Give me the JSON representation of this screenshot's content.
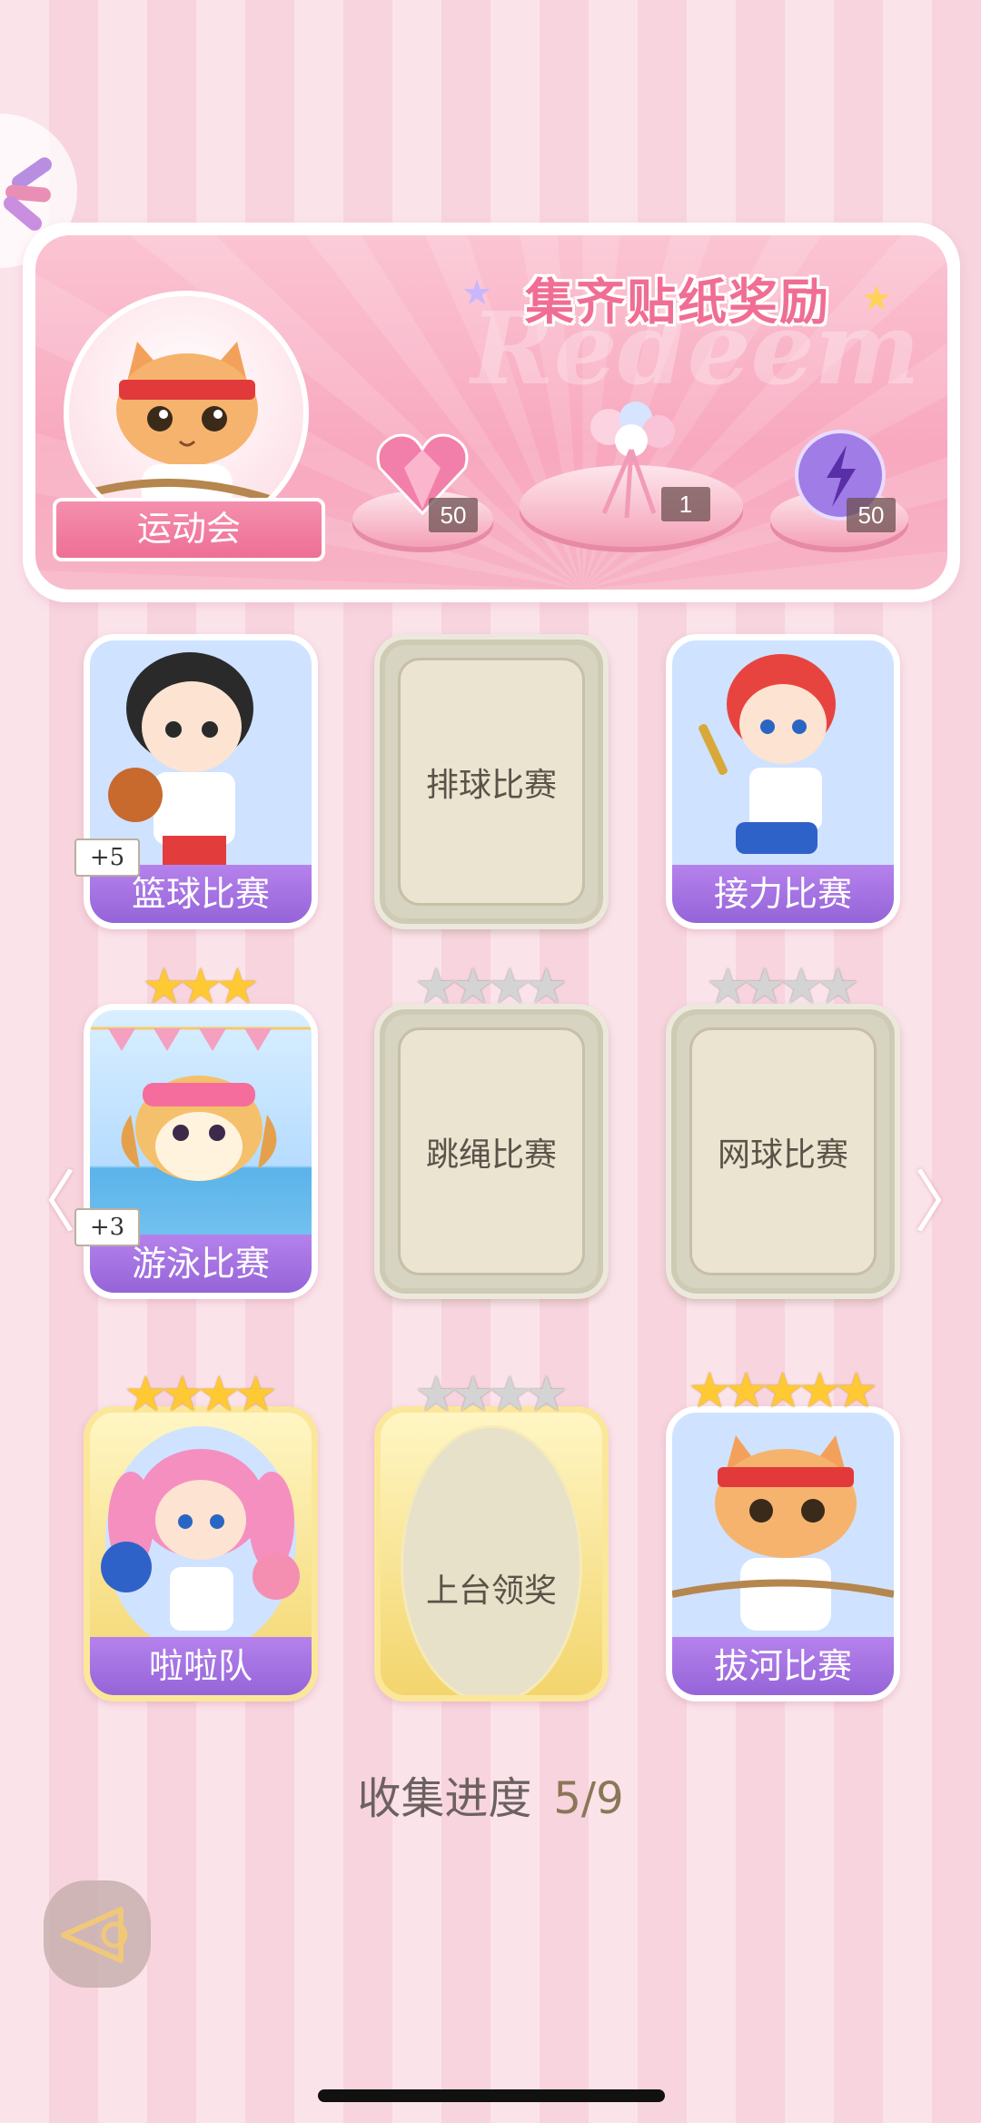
{
  "header": {
    "title": "集齐贴纸奖励",
    "watermark": "Redeem"
  },
  "event": {
    "name": "运动会"
  },
  "rewards": [
    {
      "icon": "pink-heart-gem-icon",
      "quantity": "50"
    },
    {
      "icon": "ribbon-bouquet-icon",
      "quantity": "1"
    },
    {
      "icon": "purple-energy-orb-icon",
      "quantity": "50"
    }
  ],
  "cards": [
    {
      "name": "篮球比赛",
      "state": "collected",
      "stars": 0,
      "bonus": "+5"
    },
    {
      "name": "排球比赛",
      "state": "locked",
      "stars": 0
    },
    {
      "name": "接力比赛",
      "state": "collected",
      "stars": 0
    },
    {
      "name": "游泳比赛",
      "state": "collected",
      "stars": 3,
      "bonus": "+3"
    },
    {
      "name": "跳绳比赛",
      "state": "locked",
      "stars": 4
    },
    {
      "name": "网球比赛",
      "state": "locked",
      "stars": 4
    },
    {
      "name": "啦啦队",
      "state": "collected",
      "stars": 4
    },
    {
      "name": "上台领奖",
      "state": "locked-gold",
      "stars": 4
    },
    {
      "name": "拔河比赛",
      "state": "collected",
      "stars": 5
    }
  ],
  "progress": {
    "label": "收集进度",
    "value": "5/9"
  }
}
